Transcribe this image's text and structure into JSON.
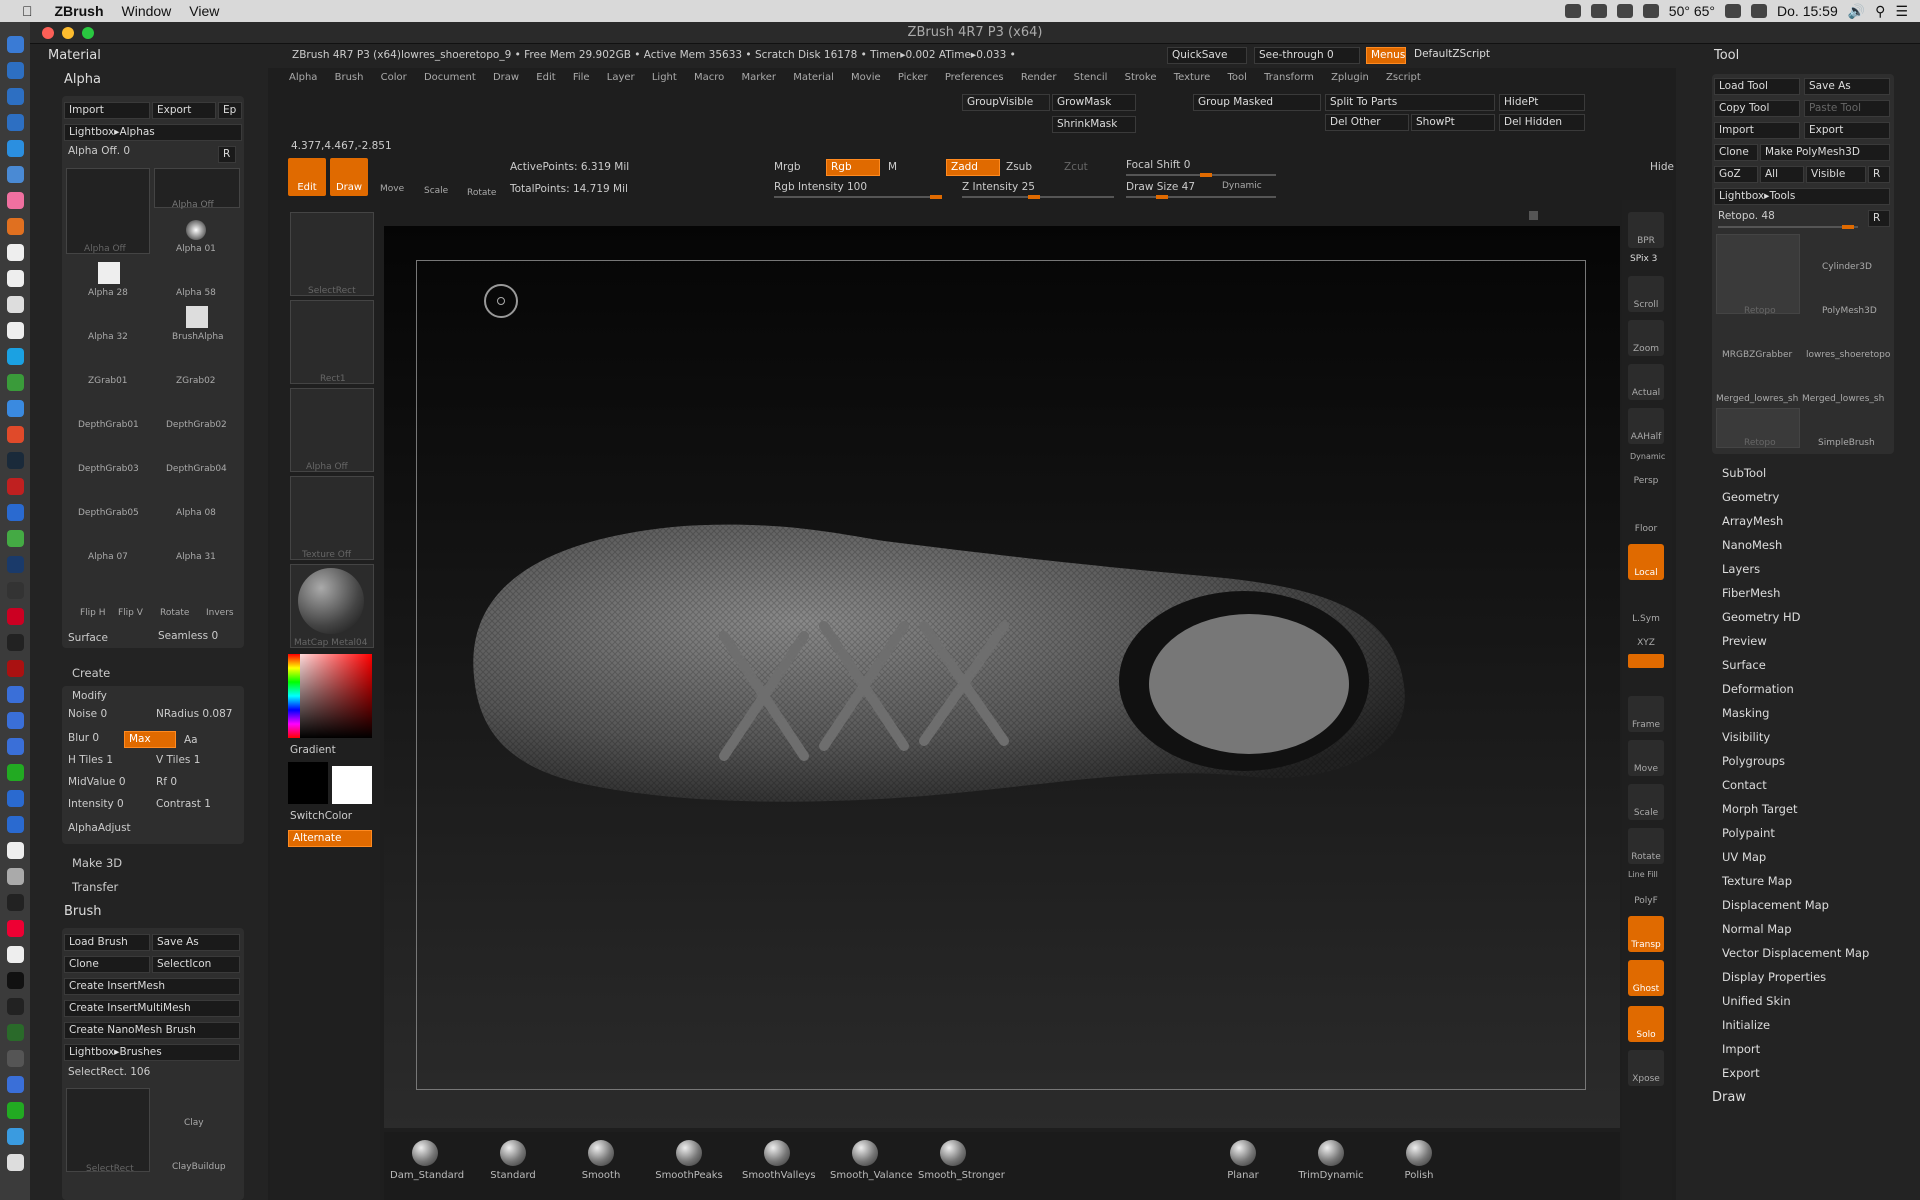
{
  "macmenu": {
    "app": "ZBrush",
    "items": [
      "Window",
      "View"
    ],
    "right_temp": "50° 65°",
    "clock": "Do. 15:59"
  },
  "window": {
    "title": "ZBrush 4R7 P3 (x64)"
  },
  "statusbar": {
    "info": "ZBrush 4R7 P3 (x64)lowres_shoeretopo_9    • Free Mem 29.902GB • Active Mem 35633 • Scratch Disk 16178 • Timer▸0.002 ATime▸0.033 •",
    "quicksave": "QuickSave",
    "seethrough": "See-through 0",
    "menus": "Menus",
    "script": "DefaultZScript"
  },
  "topmenu": [
    "Alpha",
    "Brush",
    "Color",
    "Document",
    "Draw",
    "Edit",
    "File",
    "Layer",
    "Light",
    "Macro",
    "Marker",
    "Material",
    "Movie",
    "Picker",
    "Preferences",
    "Render",
    "Stencil",
    "Stroke",
    "Texture",
    "Tool",
    "Transform",
    "Zplugin",
    "Zscript"
  ],
  "coords": "4.377,4.467,-2.851",
  "toolbar": {
    "edit": "Edit",
    "draw": "Draw",
    "move": "Move",
    "scale": "Scale",
    "rotate": "Rotate",
    "active_points": "ActivePoints: 6.319 Mil",
    "total_points": "TotalPoints: 14.719 Mil",
    "mrgb": "Mrgb",
    "rgb": "Rgb",
    "m": "M",
    "zadd": "Zadd",
    "zsub": "Zsub",
    "zcut": "Zcut",
    "rgb_intensity": "Rgb Intensity 100",
    "z_intensity": "Z Intensity 25",
    "focal_shift": "Focal Shift 0",
    "draw_size": "Draw Size 47",
    "dynamic": "Dynamic",
    "hide": "Hide"
  },
  "subtool_buttons": {
    "group_visible": "GroupVisible",
    "grow_mask": "GrowMask",
    "shrink_mask": "ShrinkMask",
    "group_masked": "Group Masked",
    "split_to_parts": "Split To Parts",
    "del_other": "Del Other",
    "show_pt": "ShowPt",
    "hide_pt": "HidePt",
    "del_hidden": "Del Hidden"
  },
  "left": {
    "material": "Material",
    "alpha": "Alpha",
    "import": "Import",
    "export": "Export",
    "ep": "Ep",
    "lightbox_alphas": "Lightbox▸Alphas",
    "alpha_off_slider": "Alpha Off. 0",
    "r": "R",
    "alphas": [
      "Alpha Off",
      "Alpha Off",
      "Alpha 01",
      "Alpha 28",
      "Alpha 58",
      "Alpha 32",
      "BrushAlpha",
      "ZGrab01",
      "ZGrab02",
      "DepthGrab01",
      "DepthGrab02",
      "DepthGrab03",
      "DepthGrab04",
      "DepthGrab05",
      "Alpha 08",
      "Alpha 07",
      "Alpha 31"
    ],
    "flip_h": "Flip H",
    "flip_v": "Flip V",
    "rotate": "Rotate",
    "invers": "Invers",
    "surface": "Surface",
    "seamless": "Seamless 0",
    "create": "Create",
    "modify": "Modify",
    "noise": "Noise 0",
    "nradius": "NRadius 0.087",
    "blur": "Blur 0",
    "max": "Max",
    "aa": "Aa",
    "h_tiles": "H Tiles 1",
    "v_tiles": "V Tiles 1",
    "midvalue": "MidValue 0",
    "rf": "Rf 0",
    "intensity": "Intensity 0",
    "contrast": "Contrast 1",
    "alphaadjust": "AlphaAdjust",
    "make3d": "Make 3D",
    "transfer": "Transfer",
    "brush": "Brush",
    "load_brush": "Load Brush",
    "save_as": "Save As",
    "clone": "Clone",
    "selecticon": "SelectIcon",
    "create_insertmesh": "Create InsertMesh",
    "create_insertmultimesh": "Create InsertMultiMesh",
    "create_nanomesh": "Create NanoMesh Brush",
    "lightbox_brushes": "Lightbox▸Brushes",
    "selectrect": "SelectRect. 106",
    "brush_thumbs": [
      "SelectRect",
      "Clay",
      "ClayBuildup"
    ]
  },
  "shelf": {
    "selectrect": "SelectRect",
    "rect1": "Rect1",
    "alpha_off": "Alpha Off",
    "texture_off": "Texture Off",
    "matcap": "MatCap Metal04",
    "gradient": "Gradient",
    "switchcolor": "SwitchColor",
    "alternate": "Alternate"
  },
  "right_nav": {
    "bpr": "BPR",
    "spix": "SPix 3",
    "scroll": "Scroll",
    "zoom": "Zoom",
    "actual": "Actual",
    "aahalf": "AAHalf",
    "persp": "Persp",
    "floor": "Floor",
    "local": "Local",
    "lsym": "L.Sym",
    "xyz": "XYZ",
    "frame": "Frame",
    "move": "Move",
    "scale": "Scale",
    "rotate": "Rotate",
    "polyf": "PolyF",
    "transp": "Transp",
    "ghost": "Ghost",
    "solo": "Solo",
    "xpose": "Xpose",
    "dynamic": "Dynamic",
    "line_fill": "Line Fill"
  },
  "tool": {
    "title": "Tool",
    "load_tool": "Load Tool",
    "save_as": "Save As",
    "copy_tool": "Copy Tool",
    "paste_tool": "Paste Tool",
    "import": "Import",
    "export": "Export",
    "clone": "Clone",
    "make_polymesh": "Make PolyMesh3D",
    "goz": "GoZ",
    "all": "All",
    "visible": "Visible",
    "r": "R",
    "lightbox_tools": "Lightbox▸Tools",
    "retopo_slider": "Retopo. 48",
    "thumbs": [
      "Retopo",
      "Cylinder3D",
      "PolyMesh3D",
      "MRGBZGrabber",
      "lowres_shoeretopo",
      "Merged_lowres_sh",
      "Merged_lowres_sh",
      "Retopo",
      "SimpleBrush"
    ],
    "menu": [
      "SubTool",
      "Geometry",
      "ArrayMesh",
      "NanoMesh",
      "Layers",
      "FiberMesh",
      "Geometry HD",
      "Preview",
      "Surface",
      "Deformation",
      "Masking",
      "Visibility",
      "Polygroups",
      "Contact",
      "Morph Target",
      "Polypaint",
      "UV Map",
      "Texture Map",
      "Displacement Map",
      "Normal Map",
      "Vector Displacement Map",
      "Display Properties",
      "Unified Skin",
      "Initialize",
      "Import",
      "Export"
    ],
    "draw": "Draw"
  },
  "bottom_brushes": [
    "Dam_Standard",
    "Standard",
    "Smooth",
    "SmoothPeaks",
    "SmoothValleys",
    "Smooth_Valance",
    "Smooth_Stronger",
    "Planar",
    "TrimDynamic",
    "Polish"
  ]
}
